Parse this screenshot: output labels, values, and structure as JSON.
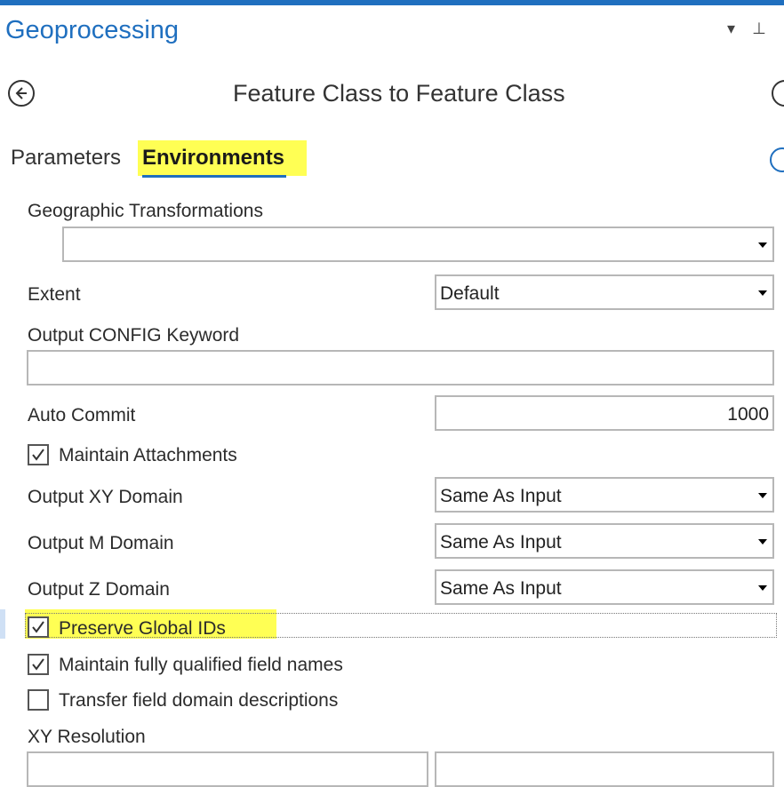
{
  "pane": {
    "title": "Geoprocessing",
    "controls": [
      "▾",
      "⊥"
    ]
  },
  "tool": {
    "title": "Feature Class to Feature Class"
  },
  "tabs": [
    {
      "label": "Parameters",
      "active": false
    },
    {
      "label": "Environments",
      "active": true
    }
  ],
  "env": {
    "geographic_transformations_label": "Geographic Transformations",
    "geographic_transformations_value": "",
    "extent_label": "Extent",
    "extent_value": "Default",
    "output_config_label": "Output CONFIG Keyword",
    "output_config_value": "",
    "auto_commit_label": "Auto Commit",
    "auto_commit_value": "1000",
    "maintain_attachments_label": "Maintain Attachments",
    "maintain_attachments_checked": true,
    "output_xy_label": "Output XY Domain",
    "output_xy_value": "Same As Input",
    "output_m_label": "Output M Domain",
    "output_m_value": "Same As Input",
    "output_z_label": "Output Z Domain",
    "output_z_value": "Same As Input",
    "preserve_global_ids_label": "Preserve Global IDs",
    "preserve_global_ids_checked": true,
    "maintain_fq_label": "Maintain fully qualified field names",
    "maintain_fq_checked": true,
    "transfer_domain_label": "Transfer field domain descriptions",
    "transfer_domain_checked": false,
    "xy_resolution_label": "XY Resolution"
  },
  "colors": {
    "accent": "#1f6fbf",
    "highlight": "#ffff54"
  }
}
